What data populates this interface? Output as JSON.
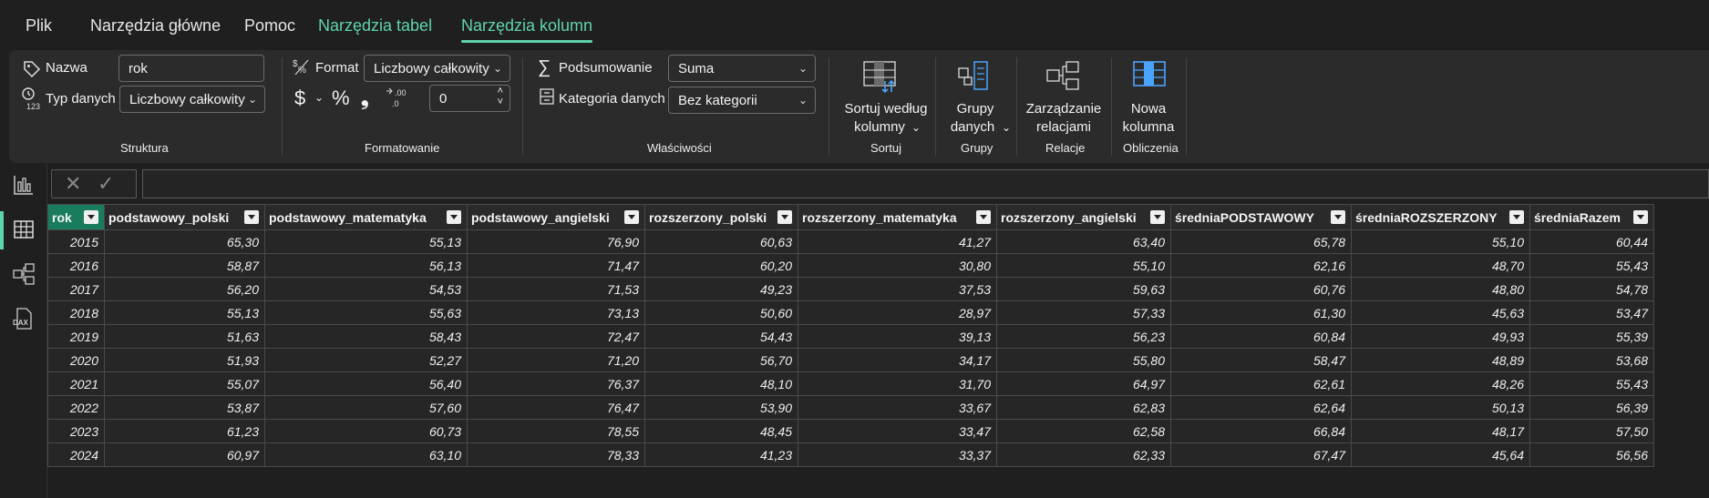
{
  "menu": {
    "items": [
      "Plik",
      "Narzędzia główne",
      "Pomoc",
      "Narzędzia tabel",
      "Narzędzia kolumn"
    ]
  },
  "ribbon": {
    "structure": {
      "name_label": "Nazwa",
      "name_value": "rok",
      "datatype_label": "Typ danych",
      "datatype_value": "Liczbowy całkowity",
      "group_label": "Struktura"
    },
    "formatting": {
      "format_label": "Format",
      "format_value": "Liczbowy całkowity",
      "currency_symbol": "$",
      "percent_symbol": "%",
      "comma_symbol": "❟",
      "decimals_value": "0",
      "group_label": "Formatowanie"
    },
    "properties": {
      "summary_label": "Podsumowanie",
      "summary_value": "Suma",
      "category_label": "Kategoria danych",
      "category_value": "Bez kategorii",
      "group_label": "Właściwości"
    },
    "sort": {
      "button_line1": "Sortuj według",
      "button_line2": "kolumny",
      "group_label": "Sortuj"
    },
    "groups": {
      "button_line1": "Grupy",
      "button_line2": "danych",
      "group_label": "Grupy"
    },
    "relations": {
      "button_line1": "Zarządzanie",
      "button_line2": "relacjami",
      "group_label": "Relacje"
    },
    "calculations": {
      "button_line1": "Nowa",
      "button_line2": "kolumna",
      "group_label": "Obliczenia"
    }
  },
  "colors": {
    "accent": "#5fd3ae",
    "selected_header": "#1a7c5e"
  },
  "table": {
    "columns": [
      "rok",
      "podstawowy_polski",
      "podstawowy_matematyka",
      "podstawowy_angielski",
      "rozszerzony_polski",
      "rozszerzony_matematyka",
      "rozszerzony_angielski",
      "średniaPODSTAWOWY",
      "średniaROZSZERZONY",
      "średniaRazem"
    ],
    "rows": [
      [
        "2015",
        "65,30",
        "55,13",
        "76,90",
        "60,63",
        "41,27",
        "63,40",
        "65,78",
        "55,10",
        "60,44"
      ],
      [
        "2016",
        "58,87",
        "56,13",
        "71,47",
        "60,20",
        "30,80",
        "55,10",
        "62,16",
        "48,70",
        "55,43"
      ],
      [
        "2017",
        "56,20",
        "54,53",
        "71,53",
        "49,23",
        "37,53",
        "59,63",
        "60,76",
        "48,80",
        "54,78"
      ],
      [
        "2018",
        "55,13",
        "55,63",
        "73,13",
        "50,60",
        "28,97",
        "57,33",
        "61,30",
        "45,63",
        "53,47"
      ],
      [
        "2019",
        "51,63",
        "58,43",
        "72,47",
        "54,43",
        "39,13",
        "56,23",
        "60,84",
        "49,93",
        "55,39"
      ],
      [
        "2020",
        "51,93",
        "52,27",
        "71,20",
        "56,70",
        "34,17",
        "55,80",
        "58,47",
        "48,89",
        "53,68"
      ],
      [
        "2021",
        "55,07",
        "56,40",
        "76,37",
        "48,10",
        "31,70",
        "64,97",
        "62,61",
        "48,26",
        "55,43"
      ],
      [
        "2022",
        "53,87",
        "57,60",
        "76,47",
        "53,90",
        "33,67",
        "62,83",
        "62,64",
        "50,13",
        "56,39"
      ],
      [
        "2023",
        "61,23",
        "60,73",
        "78,55",
        "48,45",
        "33,47",
        "62,58",
        "66,84",
        "48,17",
        "57,50"
      ],
      [
        "2024",
        "60,97",
        "63,10",
        "78,33",
        "41,23",
        "33,37",
        "62,33",
        "67,47",
        "45,64",
        "56,56"
      ]
    ]
  }
}
